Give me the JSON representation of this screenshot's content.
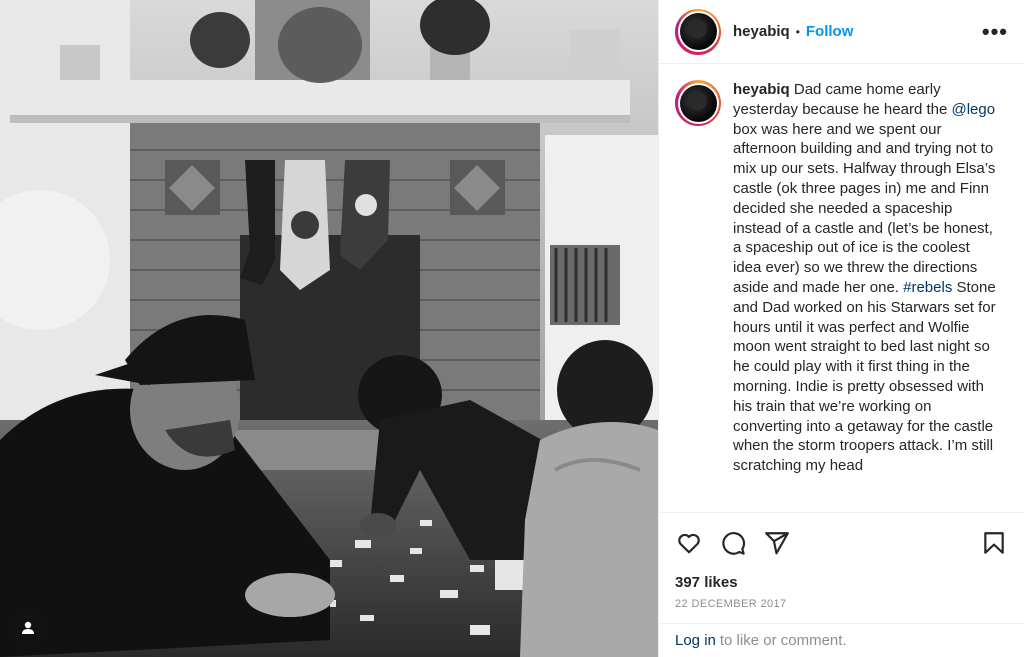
{
  "photo": {
    "alt_icon": "user-tag-icon"
  },
  "header": {
    "username": "heyabiq",
    "separator": "•",
    "follow_label": "Follow",
    "more_label": "•••"
  },
  "caption": {
    "username": "heyabiq",
    "text_1": "Dad came home early yesterday because he heard the ",
    "mention": "@lego",
    "text_2": " box was here and we spent our afternoon building and and trying not to mix up our sets. Halfway through Elsa’s castle (ok three pages in) me and Finn decided she needed a spaceship instead of a castle and (let’s be honest, a spaceship out of ice is the coolest idea ever) so we threw the directions aside and made her one. ",
    "hashtag": "#rebels",
    "text_3": " Stone and Dad worked on his Starwars set for hours until it was perfect and Wolfie moon went straight to bed last night so he could play with it first thing in the morning. Indie is pretty obsessed with his train that we’re working on converting into a getaway for the castle when the storm troopers attack. I’m still scratching my head"
  },
  "actions": {
    "like_icon": "heart-icon",
    "comment_icon": "comment-icon",
    "share_icon": "share-icon",
    "save_icon": "bookmark-icon"
  },
  "likes": "397 likes",
  "date": "22 DECEMBER 2017",
  "login": {
    "link_label": "Log in",
    "suffix": "to like or comment."
  },
  "colors": {
    "accent": "#0095f6",
    "link": "#00376b",
    "muted": "#8e8e8e",
    "text": "#262626"
  }
}
